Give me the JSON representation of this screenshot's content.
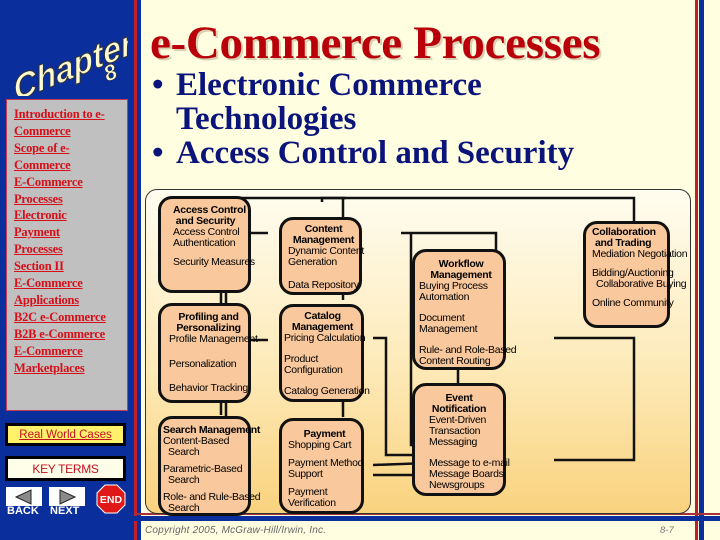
{
  "sidebar": {
    "chapter_word": "Chapter",
    "chapter_number": "8",
    "links": [
      "Introduction to e-",
      "Commerce",
      "Scope of e-",
      "Commerce",
      "E-Commerce",
      "Processes",
      "Electronic",
      "Payment",
      "Processes",
      "Section II",
      "E-Commerce",
      "Applications",
      "B2C e-Commerce",
      "B2B e-Commerce",
      "E-Commerce",
      "Marketplaces"
    ],
    "real_world_cases": "Real World Cases",
    "key_terms": "KEY TERMS",
    "back": "BACK",
    "next": "NEXT",
    "end": "END"
  },
  "header": {
    "title": "e-Commerce Processes"
  },
  "bullets": {
    "b1_line1": "Electronic Commerce",
    "b1_line2": "Technologies",
    "b2": "Access Control and Security",
    "dot": "•"
  },
  "diagram": {
    "boxes": {
      "access": {
        "title": [
          "Access Control",
          "and Security"
        ],
        "items": [
          "Access Control",
          "Authentication",
          "",
          "Security Measures"
        ]
      },
      "profiling": {
        "title": [
          "Profiling and",
          "Personalizing"
        ],
        "items": [
          "Profile Management",
          "",
          "Personalization",
          "",
          "Behavior Tracking"
        ]
      },
      "search": {
        "title": [
          "Search Management"
        ],
        "items": [
          "Content-Based",
          "  Search",
          "",
          "Parametric-Based",
          "  Search",
          "",
          "Role- and Rule-Based",
          "  Search"
        ]
      },
      "content": {
        "title": [
          "Content",
          "Management"
        ],
        "items": [
          "Dynamic Content",
          "Generation",
          "",
          "Data Repository"
        ]
      },
      "catalog": {
        "title": [
          "Catalog",
          "Management"
        ],
        "items": [
          "Pricing Calculation",
          "",
          "Product",
          "Configuration",
          "",
          "Catalog Generation"
        ]
      },
      "payment": {
        "title": [
          "Payment"
        ],
        "items": [
          "Shopping Cart",
          "",
          "Payment Method",
          "Support",
          "",
          "Payment",
          "Verification"
        ]
      },
      "workflow": {
        "title": [
          "Workflow",
          "Management"
        ],
        "items": [
          "Buying Process",
          "Automation",
          "",
          "Document",
          "Management",
          "",
          "Rule- and Role-Based",
          "Content Routing"
        ]
      },
      "event": {
        "title": [
          "Event",
          "Notification"
        ],
        "items": [
          "Event-Driven",
          "Transaction",
          "Messaging",
          "",
          "Message to e-mail",
          "Message Boards",
          "Newsgroups"
        ]
      },
      "collab": {
        "title": [
          "Collaboration",
          "and Trading"
        ],
        "items": [
          "Mediation Negotiation",
          "",
          "Bidding/Auctioning",
          "  Collaborative Buying",
          "",
          "Online Community"
        ]
      }
    }
  },
  "footer": {
    "copyright": "Copyright 2005, McGraw-Hill/Irwin, Inc.",
    "page_number": "8-7"
  },
  "colors": {
    "sidebar_blue": "#0a2f9c",
    "title_red": "#b9000a",
    "bullet_navy": "#0a147a",
    "link_red": "#d60f19",
    "box_fill": "#f9c89c",
    "background": "#fffee0"
  }
}
